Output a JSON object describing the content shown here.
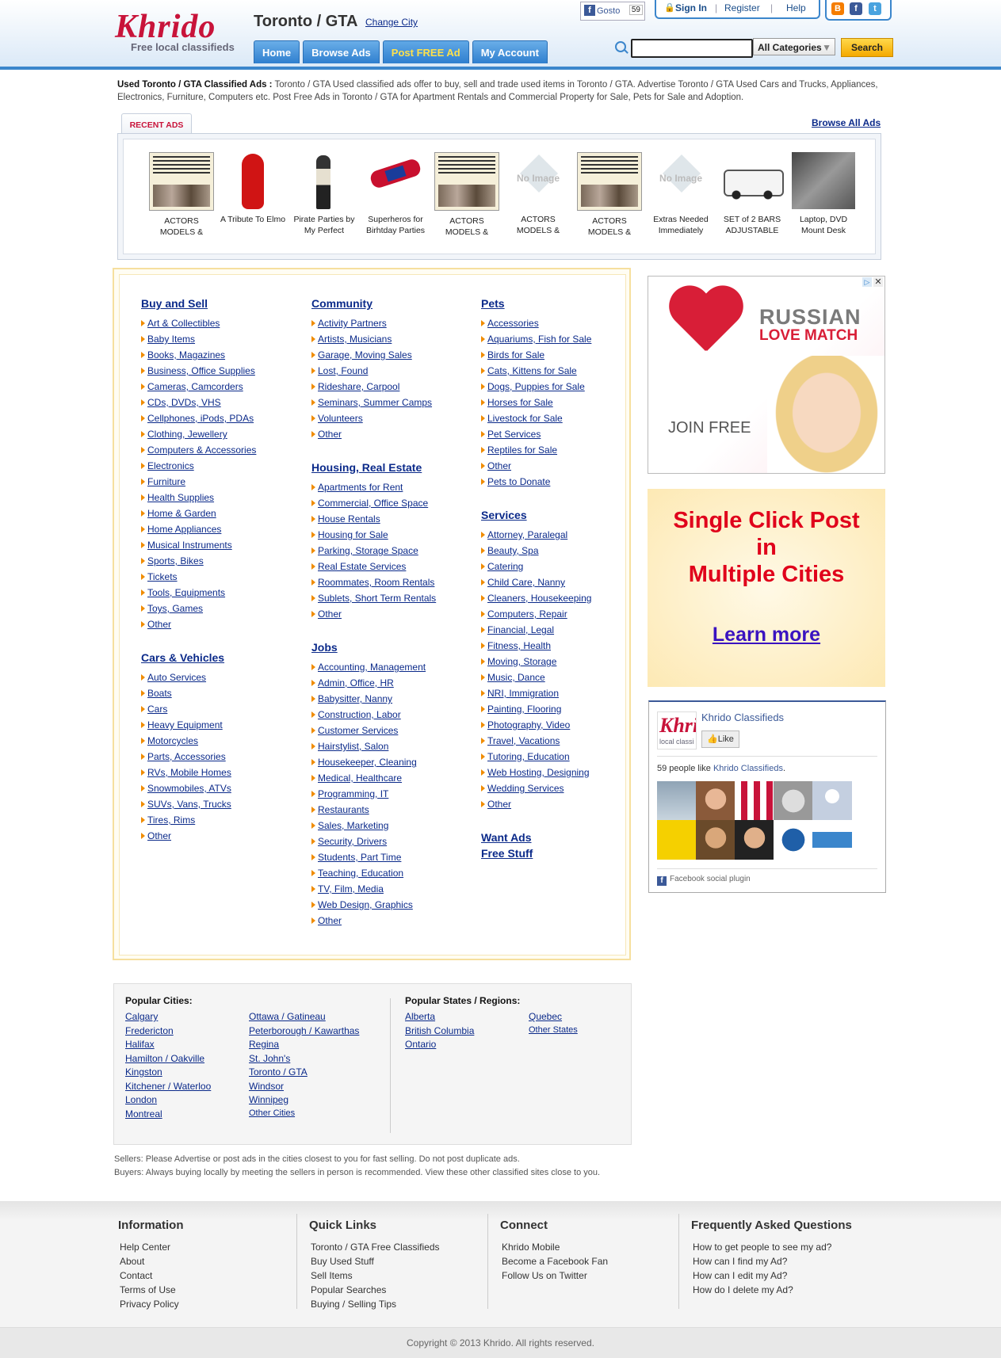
{
  "header": {
    "logo": "Khrido",
    "tagline": "Free local classifieds",
    "city": "Toronto / GTA",
    "change_city": "Change City",
    "nav": [
      "Home",
      "Browse Ads",
      "Post FREE Ad",
      "My Account"
    ],
    "gosto_label": "Gosto",
    "gosto_count": "59",
    "top_links": {
      "sign_in": "Sign In",
      "register": "Register",
      "help": "Help"
    },
    "search_placeholder": "",
    "category_selected": "All Categories",
    "search_button": "Search"
  },
  "intro": {
    "title": "Used Toronto / GTA Classified Ads :",
    "text": "Toronto / GTA Used classified ads offer to buy, sell and trade used items in Toronto / GTA. Advertise Toronto / GTA Used Cars and Trucks, Appliances, Electronics, Furniture, Computers etc. Post Free Ads in Toronto / GTA for Apartment Rentals and Commercial Property for Sale, Pets for Sale and Adoption."
  },
  "recent": {
    "tab": "RECENT ADS",
    "browse_all": "Browse All Ads",
    "ads": [
      {
        "title": "ACTORS MODELS &",
        "thumb": "poster"
      },
      {
        "title": "A Tribute To Elmo",
        "thumb": "elmo"
      },
      {
        "title": "Pirate Parties by My Perfect",
        "thumb": "pirate"
      },
      {
        "title": "Superheros for Birhtday Parties",
        "thumb": "spidey"
      },
      {
        "title": "ACTORS MODELS &",
        "thumb": "poster"
      },
      {
        "title": "ACTORS MODELS &",
        "thumb": "noimg"
      },
      {
        "title": "ACTORS MODELS &",
        "thumb": "poster"
      },
      {
        "title": "Extras Needed Immediately",
        "thumb": "noimg"
      },
      {
        "title": "SET of 2 BARS ADJUSTABLE",
        "thumb": "truck"
      },
      {
        "title": "Laptop, DVD Mount Desk",
        "thumb": "laptop"
      }
    ]
  },
  "categories": {
    "buy_sell": {
      "title": "Buy and Sell",
      "items": [
        "Art & Collectibles",
        "Baby Items",
        "Books, Magazines",
        "Business, Office Supplies",
        "Cameras, Camcorders",
        "CDs, DVDs, VHS",
        "Cellphones, iPods, PDAs",
        "Clothing, Jewellery",
        "Computers & Accessories",
        "Electronics",
        "Furniture",
        "Health Supplies",
        "Home & Garden",
        "Home Appliances",
        "Musical Instruments",
        "Sports, Bikes",
        "Tickets",
        "Tools, Equipments",
        "Toys, Games",
        "Other"
      ]
    },
    "cars": {
      "title": "Cars & Vehicles",
      "items": [
        "Auto Services",
        "Boats",
        "Cars",
        "Heavy Equipment",
        "Motorcycles",
        "Parts, Accessories",
        "RVs, Mobile Homes",
        "Snowmobiles, ATVs",
        "SUVs, Vans, Trucks",
        "Tires, Rims",
        "Other"
      ]
    },
    "community": {
      "title": "Community",
      "items": [
        "Activity Partners",
        "Artists, Musicians",
        "Garage, Moving Sales",
        "Lost, Found",
        "Rideshare, Carpool",
        "Seminars, Summer Camps",
        "Volunteers",
        "Other"
      ]
    },
    "housing": {
      "title": "Housing, Real Estate",
      "items": [
        "Apartments for Rent",
        "Commercial, Office Space",
        "House Rentals",
        "Housing for Sale",
        "Parking, Storage Space",
        "Real Estate Services",
        "Roommates, Room Rentals",
        "Sublets, Short Term Rentals",
        "Other"
      ]
    },
    "jobs": {
      "title": "Jobs",
      "items": [
        "Accounting, Management",
        "Admin, Office, HR",
        "Babysitter, Nanny",
        "Construction, Labor",
        "Customer Services",
        "Hairstylist, Salon",
        "Housekeeper, Cleaning",
        "Medical, Healthcare",
        "Programming, IT",
        "Restaurants",
        "Sales, Marketing",
        "Security, Drivers",
        "Students, Part Time",
        "Teaching, Education",
        "TV, Film, Media",
        "Web Design, Graphics",
        "Other"
      ]
    },
    "pets": {
      "title": "Pets",
      "items": [
        "Accessories",
        "Aquariums, Fish for Sale",
        "Birds for Sale",
        "Cats, Kittens for Sale",
        "Dogs, Puppies for Sale",
        "Horses for Sale",
        "Livestock for Sale",
        "Pet Services",
        "Reptiles for Sale",
        "Other",
        "Pets to Donate"
      ]
    },
    "services": {
      "title": "Services",
      "items": [
        "Attorney, Paralegal",
        "Beauty, Spa",
        "Catering",
        "Child Care, Nanny",
        "Cleaners, Housekeeping",
        "Computers, Repair",
        "Financial, Legal",
        "Fitness, Health",
        "Moving, Storage",
        "Music, Dance",
        "NRI, Immigration",
        "Painting, Flooring",
        "Photography, Video",
        "Travel, Vacations",
        "Tutoring, Education",
        "Web Hosting, Designing",
        "Wedding Services",
        "Other"
      ]
    },
    "want_ads": "Want Ads",
    "free_stuff": "Free Stuff"
  },
  "ads": {
    "russian": "RUSSIAN",
    "love_match": "LOVE MATCH",
    "join": "JOIN FREE",
    "promo_lines": [
      "Single Click Post",
      "in",
      "Multiple Cities"
    ],
    "learn_more": "Learn more"
  },
  "facebook": {
    "page_name": "Khrido Classifieds",
    "like": "Like",
    "people_prefix": "59 people like ",
    "people_link": "Khrido Classifieds",
    "people_suffix": ".",
    "plugin": "Facebook social plugin",
    "logo_small": "Khrido",
    "logo_small_sub": "local classi"
  },
  "popular": {
    "cities_title": "Popular Cities:",
    "cities_col1": [
      "Calgary",
      "Fredericton",
      "Halifax",
      "Hamilton / Oakville",
      "Kingston",
      "Kitchener / Waterloo",
      "London",
      "Montreal"
    ],
    "cities_col2": [
      "Ottawa / Gatineau",
      "Peterborough / Kawarthas",
      "Regina",
      "St. John's",
      "Toronto / GTA",
      "Windsor",
      "Winnipeg",
      "Other Cities"
    ],
    "states_title": "Popular States / Regions:",
    "states_col1": [
      "Alberta",
      "British Columbia",
      "Ontario"
    ],
    "states_col2": [
      "Quebec",
      "Other States"
    ]
  },
  "notes": {
    "sellers": "Sellers: Please Advertise or post ads in the cities closest to you for fast selling. Do not post duplicate ads.",
    "buyers": "Buyers: Always buying locally by meeting the sellers in person is recommended. View these other classified sites close to you."
  },
  "footer": {
    "information": {
      "title": "Information",
      "items": [
        "Help Center",
        "About",
        "Contact",
        "Terms of Use",
        "Privacy Policy"
      ]
    },
    "quick_links": {
      "title": "Quick Links",
      "items": [
        "Toronto / GTA Free Classifieds",
        "Buy Used Stuff",
        "Sell Items",
        "Popular Searches",
        "Buying / Selling Tips"
      ]
    },
    "connect": {
      "title": "Connect",
      "items": [
        "Khrido Mobile",
        "Become a Facebook Fan",
        "Follow Us on Twitter"
      ]
    },
    "faq": {
      "title": "Frequently Asked Questions",
      "items": [
        "How to get people to see my ad?",
        "How can I find my Ad?",
        "How can I edit my Ad?",
        "How do I delete my Ad?"
      ]
    },
    "copyright": "Copyright © 2013 Khrido. All rights reserved."
  },
  "colors": {
    "brand": "#c8133a",
    "nav": "#3b86cc",
    "link": "#0b2a8a",
    "accent": "#f08c00"
  }
}
